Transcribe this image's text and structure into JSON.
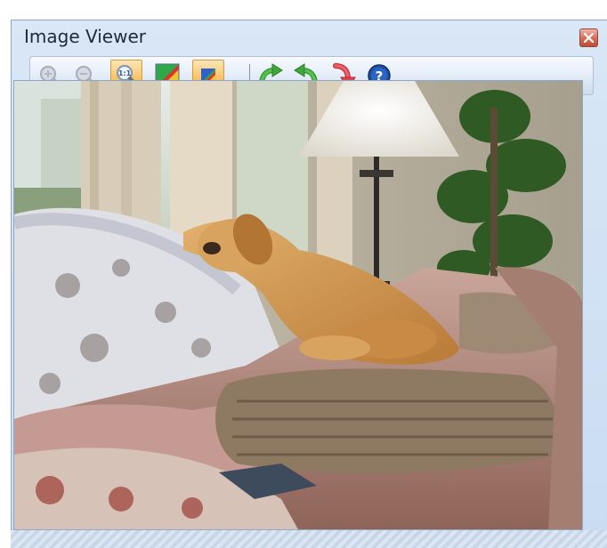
{
  "window": {
    "title": "Image Viewer",
    "close_icon": "close-icon"
  },
  "toolbar": {
    "buttons": [
      {
        "name": "zoom-in-icon",
        "state": "disabled"
      },
      {
        "name": "zoom-out-icon",
        "state": "disabled"
      },
      {
        "name": "actual-size-icon",
        "state": "active"
      },
      {
        "name": "fit-color-icon",
        "state": "normal"
      },
      {
        "name": "fit-window-icon",
        "state": "active"
      },
      {
        "name": "rotate-right-icon",
        "state": "normal"
      },
      {
        "name": "rotate-left-icon",
        "state": "normal"
      },
      {
        "name": "flip-icon",
        "state": "normal"
      },
      {
        "name": "help-icon",
        "state": "normal"
      }
    ]
  },
  "viewer": {
    "image_content": "golden-retriever-on-sofa-photo"
  },
  "colors": {
    "title_bar": "#d9e7f6",
    "active_button": "#f9c56d",
    "close_button": "#d46a55",
    "rotate_arrow_green": "#3ea63a",
    "flip_arrow_red": "#e2474f",
    "help_blue": "#1f4fa3"
  }
}
